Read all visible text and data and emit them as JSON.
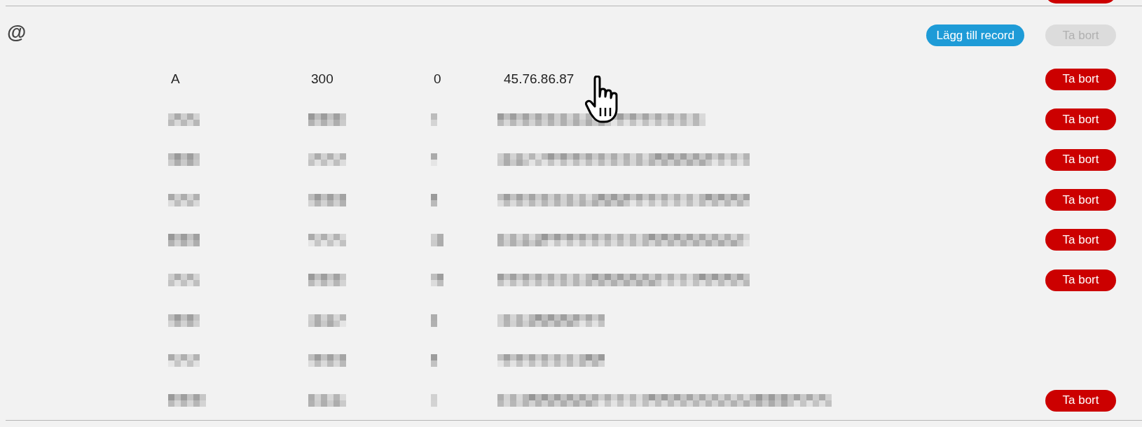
{
  "previous_section": {
    "delete_button_visible": true
  },
  "zone": {
    "name": "@",
    "add_button": {
      "label": "Lägg till record"
    },
    "delete_button": {
      "label": "Ta bort",
      "disabled": true
    }
  },
  "records": [
    {
      "kind": "record",
      "type": "A",
      "ttl": "300",
      "priority": "0",
      "value": "45.76.86.87",
      "delete_button": {
        "label": "Ta bort"
      }
    },
    {
      "kind": "redacted",
      "delete_button": {
        "label": "Ta bort"
      }
    },
    {
      "kind": "redacted",
      "delete_button": {
        "label": "Ta bort"
      }
    },
    {
      "kind": "redacted",
      "delete_button": {
        "label": "Ta bort"
      }
    },
    {
      "kind": "redacted",
      "delete_button": {
        "label": "Ta bort"
      }
    },
    {
      "kind": "redacted",
      "delete_button": {
        "label": "Ta bort"
      }
    },
    {
      "kind": "redacted"
    },
    {
      "kind": "redacted"
    },
    {
      "kind": "redacted",
      "delete_button": {
        "label": "Ta bort"
      }
    }
  ],
  "cursor": {
    "kind": "hand"
  }
}
